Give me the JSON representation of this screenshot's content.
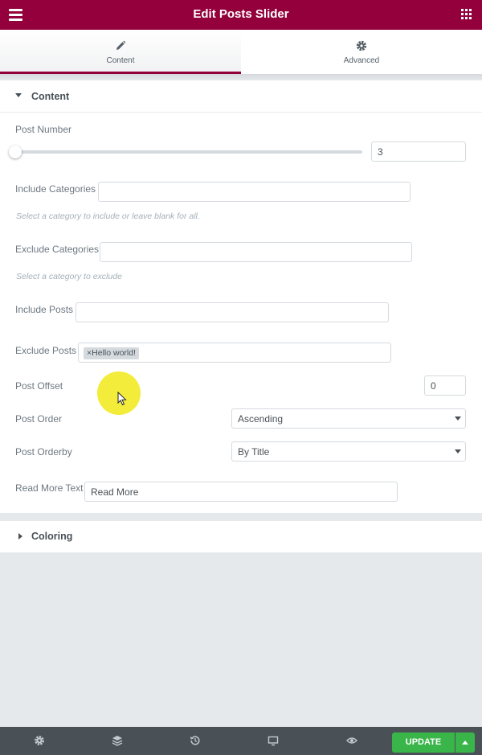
{
  "header": {
    "title": "Edit Posts Slider",
    "menu_icon": "hamburger-menu-icon",
    "apps_icon": "grid-apps-icon"
  },
  "tabs": [
    {
      "label": "Content",
      "icon": "pencil-icon",
      "active": true
    },
    {
      "label": "Advanced",
      "icon": "gear-icon",
      "active": false
    }
  ],
  "content_section": {
    "title": "Content",
    "post_number": {
      "label": "Post Number",
      "value": "3",
      "slider_fraction": 0.0
    },
    "include_categories": {
      "label": "Include Categories",
      "value": "",
      "description": "Select a category to include or leave blank for all."
    },
    "exclude_categories": {
      "label": "Exclude Categories",
      "value": "",
      "description": "Select a category to exclude"
    },
    "include_posts": {
      "label": "Include Posts",
      "value": ""
    },
    "exclude_posts": {
      "label": "Exclude Posts",
      "tags": [
        {
          "remove": "×",
          "text": "Hello world!"
        }
      ]
    },
    "post_offset": {
      "label": "Post Offset",
      "value": "0"
    },
    "post_order": {
      "label": "Post Order",
      "selected": "Ascending"
    },
    "post_orderby": {
      "label": "Post Orderby",
      "selected": "By Title"
    },
    "read_more": {
      "label": "Read More Text",
      "value": "Read More"
    }
  },
  "coloring_section": {
    "title": "Coloring"
  },
  "footer": {
    "icons": [
      "settings-icon",
      "layers-icon",
      "history-icon",
      "responsive-desktop-icon",
      "preview-eye-icon"
    ],
    "update_label": "UPDATE"
  },
  "colors": {
    "brand": "#93003c",
    "update": "#39b54a",
    "footer": "#495157",
    "cursor_highlight": "#f2ea25"
  }
}
